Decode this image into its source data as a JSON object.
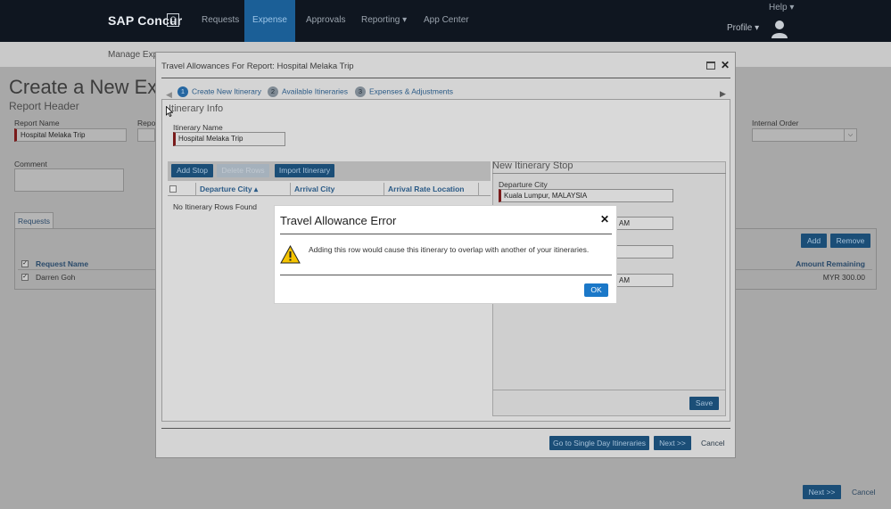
{
  "nav": {
    "logo": "SAP Concur",
    "logo_mark": "C",
    "items": [
      "Requests",
      "Expense",
      "Approvals",
      "Reporting ▾",
      "App Center"
    ],
    "help": "Help ▾",
    "profile": "Profile ▾"
  },
  "background": {
    "subnav_title": "Manage Expe",
    "page_title": "Create a New Expe",
    "section_title": "Report Header",
    "report_name_label": "Report Name",
    "report_name_value": "Hospital Melaka Trip",
    "report_label_partial": "Repo",
    "internal_order_label": "Internal Order",
    "comment_label": "Comment",
    "tab_requests": "Requests",
    "add_button": "Add",
    "remove_button": "Remove",
    "col_request_name": "Request Name",
    "col_amount_remaining": "Amount Remaining",
    "row_name": "Darren Goh",
    "row_amount": "MYR 300.00",
    "next_button": "Next >>",
    "cancel_link": "Cancel"
  },
  "modal": {
    "title": "Travel Allowances For Report: Hospital Melaka Trip",
    "steps": [
      {
        "num": "1",
        "label": "Create New Itinerary"
      },
      {
        "num": "2",
        "label": "Available Itineraries"
      },
      {
        "num": "3",
        "label": "Expenses & Adjustments"
      }
    ],
    "section_title": "Itinerary Info",
    "itinerary_name_label": "Itinerary Name",
    "itinerary_name_value": "Hospital Melaka Trip",
    "add_stop": "Add Stop",
    "delete_rows": "Delete Rows",
    "import_itinerary": "Import Itinerary",
    "col_departure_city": "Departure City ▴",
    "col_arrival_city": "Arrival City",
    "col_arrival_rate": "Arrival Rate Location",
    "empty_text": "No Itinerary Rows Found",
    "stop_title": "New Itinerary Stop",
    "departure_city_label": "Departure City",
    "departure_city_value": "Kuala Lumpur, MALAYSIA",
    "time_fragment_1": "AM",
    "time_fragment_2": "AM",
    "save_button": "Save",
    "go_single_day": "Go to Single Day Itineraries",
    "next_button": "Next >>",
    "cancel_link": "Cancel"
  },
  "error_dialog": {
    "title": "Travel Allowance Error",
    "message": "Adding this row would cause this itinerary to overlap with another of your itineraries.",
    "ok_button": "OK"
  }
}
